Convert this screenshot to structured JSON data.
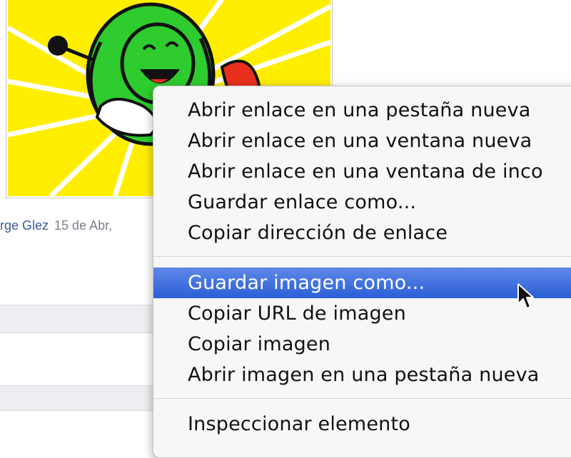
{
  "post": {
    "author": "rge Glez",
    "date": "15 de Abr,"
  },
  "context_menu": {
    "items": [
      {
        "label": "Abrir enlace en una pestaña nueva"
      },
      {
        "label": "Abrir enlace en una ventana nueva"
      },
      {
        "label": "Abrir enlace en una ventana de inco"
      },
      {
        "label": "Guardar enlace como..."
      },
      {
        "label": "Copiar dirección de enlace"
      },
      {
        "label": "Guardar imagen como...",
        "highlighted": true
      },
      {
        "label": "Copiar URL de imagen"
      },
      {
        "label": "Copiar imagen"
      },
      {
        "label": "Abrir imagen en una pestaña nueva"
      },
      {
        "label": "Inspeccionar elemento"
      }
    ]
  },
  "colors": {
    "highlight": "#3b6fdf",
    "author_link": "#3b5998",
    "cartoon_sun": "#ffee00",
    "cartoon_character": "#2ecc2e"
  }
}
